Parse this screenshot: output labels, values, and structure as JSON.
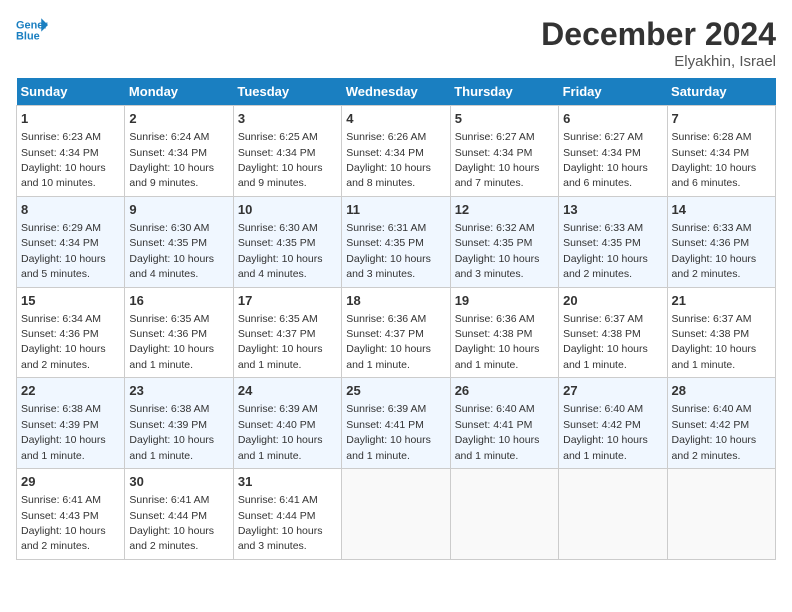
{
  "header": {
    "logo_line1": "General",
    "logo_line2": "Blue",
    "month": "December 2024",
    "location": "Elyakhin, Israel"
  },
  "weekdays": [
    "Sunday",
    "Monday",
    "Tuesday",
    "Wednesday",
    "Thursday",
    "Friday",
    "Saturday"
  ],
  "weeks": [
    [
      {
        "day": "1",
        "sunrise": "6:23 AM",
        "sunset": "4:34 PM",
        "daylight": "10 hours and 10 minutes."
      },
      {
        "day": "2",
        "sunrise": "6:24 AM",
        "sunset": "4:34 PM",
        "daylight": "10 hours and 9 minutes."
      },
      {
        "day": "3",
        "sunrise": "6:25 AM",
        "sunset": "4:34 PM",
        "daylight": "10 hours and 9 minutes."
      },
      {
        "day": "4",
        "sunrise": "6:26 AM",
        "sunset": "4:34 PM",
        "daylight": "10 hours and 8 minutes."
      },
      {
        "day": "5",
        "sunrise": "6:27 AM",
        "sunset": "4:34 PM",
        "daylight": "10 hours and 7 minutes."
      },
      {
        "day": "6",
        "sunrise": "6:27 AM",
        "sunset": "4:34 PM",
        "daylight": "10 hours and 6 minutes."
      },
      {
        "day": "7",
        "sunrise": "6:28 AM",
        "sunset": "4:34 PM",
        "daylight": "10 hours and 6 minutes."
      }
    ],
    [
      {
        "day": "8",
        "sunrise": "6:29 AM",
        "sunset": "4:34 PM",
        "daylight": "10 hours and 5 minutes."
      },
      {
        "day": "9",
        "sunrise": "6:30 AM",
        "sunset": "4:35 PM",
        "daylight": "10 hours and 4 minutes."
      },
      {
        "day": "10",
        "sunrise": "6:30 AM",
        "sunset": "4:35 PM",
        "daylight": "10 hours and 4 minutes."
      },
      {
        "day": "11",
        "sunrise": "6:31 AM",
        "sunset": "4:35 PM",
        "daylight": "10 hours and 3 minutes."
      },
      {
        "day": "12",
        "sunrise": "6:32 AM",
        "sunset": "4:35 PM",
        "daylight": "10 hours and 3 minutes."
      },
      {
        "day": "13",
        "sunrise": "6:33 AM",
        "sunset": "4:35 PM",
        "daylight": "10 hours and 2 minutes."
      },
      {
        "day": "14",
        "sunrise": "6:33 AM",
        "sunset": "4:36 PM",
        "daylight": "10 hours and 2 minutes."
      }
    ],
    [
      {
        "day": "15",
        "sunrise": "6:34 AM",
        "sunset": "4:36 PM",
        "daylight": "10 hours and 2 minutes."
      },
      {
        "day": "16",
        "sunrise": "6:35 AM",
        "sunset": "4:36 PM",
        "daylight": "10 hours and 1 minute."
      },
      {
        "day": "17",
        "sunrise": "6:35 AM",
        "sunset": "4:37 PM",
        "daylight": "10 hours and 1 minute."
      },
      {
        "day": "18",
        "sunrise": "6:36 AM",
        "sunset": "4:37 PM",
        "daylight": "10 hours and 1 minute."
      },
      {
        "day": "19",
        "sunrise": "6:36 AM",
        "sunset": "4:38 PM",
        "daylight": "10 hours and 1 minute."
      },
      {
        "day": "20",
        "sunrise": "6:37 AM",
        "sunset": "4:38 PM",
        "daylight": "10 hours and 1 minute."
      },
      {
        "day": "21",
        "sunrise": "6:37 AM",
        "sunset": "4:38 PM",
        "daylight": "10 hours and 1 minute."
      }
    ],
    [
      {
        "day": "22",
        "sunrise": "6:38 AM",
        "sunset": "4:39 PM",
        "daylight": "10 hours and 1 minute."
      },
      {
        "day": "23",
        "sunrise": "6:38 AM",
        "sunset": "4:39 PM",
        "daylight": "10 hours and 1 minute."
      },
      {
        "day": "24",
        "sunrise": "6:39 AM",
        "sunset": "4:40 PM",
        "daylight": "10 hours and 1 minute."
      },
      {
        "day": "25",
        "sunrise": "6:39 AM",
        "sunset": "4:41 PM",
        "daylight": "10 hours and 1 minute."
      },
      {
        "day": "26",
        "sunrise": "6:40 AM",
        "sunset": "4:41 PM",
        "daylight": "10 hours and 1 minute."
      },
      {
        "day": "27",
        "sunrise": "6:40 AM",
        "sunset": "4:42 PM",
        "daylight": "10 hours and 1 minute."
      },
      {
        "day": "28",
        "sunrise": "6:40 AM",
        "sunset": "4:42 PM",
        "daylight": "10 hours and 2 minutes."
      }
    ],
    [
      {
        "day": "29",
        "sunrise": "6:41 AM",
        "sunset": "4:43 PM",
        "daylight": "10 hours and 2 minutes."
      },
      {
        "day": "30",
        "sunrise": "6:41 AM",
        "sunset": "4:44 PM",
        "daylight": "10 hours and 2 minutes."
      },
      {
        "day": "31",
        "sunrise": "6:41 AM",
        "sunset": "4:44 PM",
        "daylight": "10 hours and 3 minutes."
      },
      null,
      null,
      null,
      null
    ]
  ]
}
